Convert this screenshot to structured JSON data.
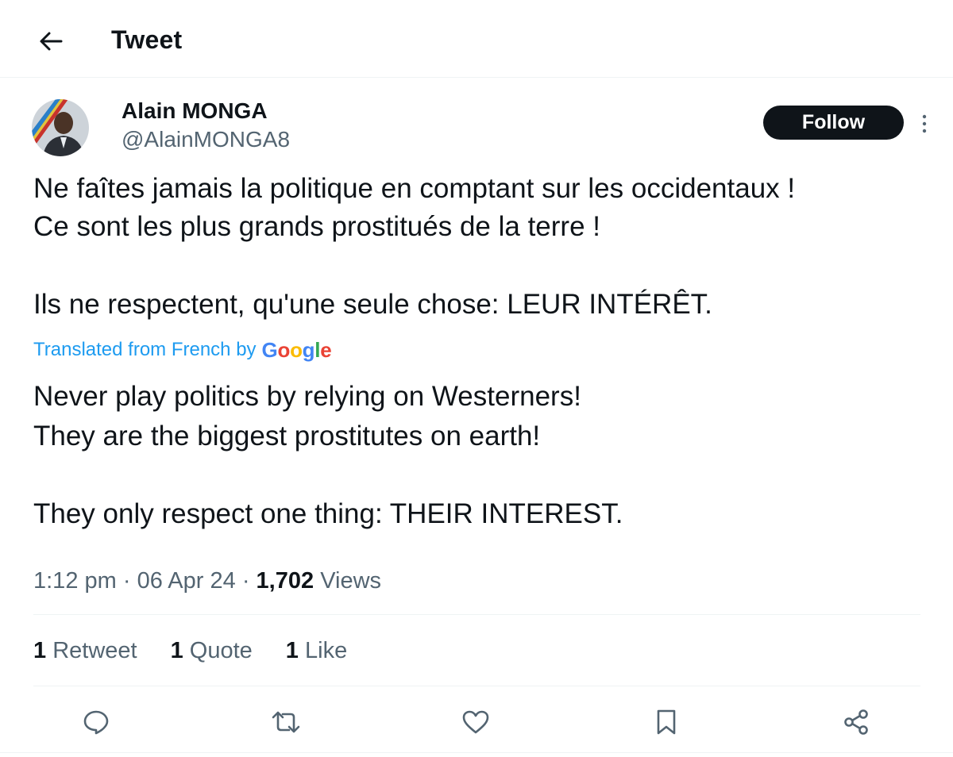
{
  "header": {
    "back_icon": "arrow-left-icon",
    "title": "Tweet"
  },
  "author": {
    "display_name": "Alain MONGA",
    "handle": "@AlainMONGA8",
    "follow_label": "Follow",
    "more_icon": "more-vertical-icon"
  },
  "tweet": {
    "original_lines": [
      "Ne faîtes jamais la politique en comptant sur les occidentaux !",
      "Ce sont les plus grands prostitués de la terre !",
      "Ils ne respectent, qu'une seule chose: LEUR INTÉRÊT."
    ],
    "translation_label": "Translated from French by",
    "translation_provider": "Google",
    "translated_lines": [
      "Never play politics by relying on Westerners!",
      "They are the biggest prostitutes on earth!",
      "They only respect one thing: THEIR INTEREST."
    ]
  },
  "meta": {
    "time": "1:12 pm",
    "separator": "·",
    "date": "06 Apr 24",
    "views_count": "1,702",
    "views_label": "Views"
  },
  "stats": [
    {
      "count": "1",
      "label": "Retweet"
    },
    {
      "count": "1",
      "label": "Quote"
    },
    {
      "count": "1",
      "label": "Like"
    }
  ],
  "actions": [
    "reply-icon",
    "retweet-icon",
    "like-icon",
    "bookmark-icon",
    "share-icon"
  ],
  "colors": {
    "text": "#0f1419",
    "secondary": "#536471",
    "link": "#1d9bf0",
    "follow_bg": "#0f1419",
    "divider": "#eff3f4"
  }
}
